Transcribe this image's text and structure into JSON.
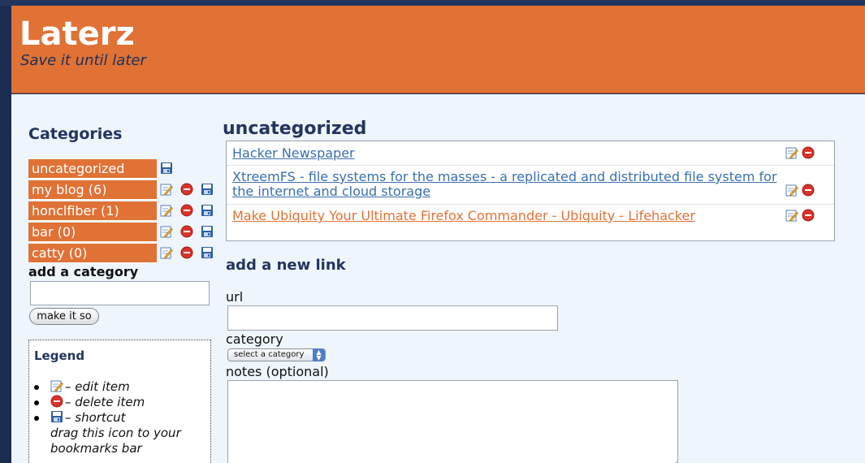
{
  "header": {
    "title": "Laterz",
    "subtitle": "Save it until later"
  },
  "sidebar": {
    "heading": "Categories",
    "categories": [
      {
        "label": "uncategorized",
        "icons": [
          "shortcut-icon"
        ]
      },
      {
        "label": "my blog (6)",
        "icons": [
          "edit-icon",
          "delete-icon",
          "shortcut-icon"
        ]
      },
      {
        "label": "honclfiber (1)",
        "icons": [
          "edit-icon",
          "delete-icon",
          "shortcut-icon"
        ]
      },
      {
        "label": "bar (0)",
        "icons": [
          "edit-icon",
          "delete-icon",
          "shortcut-icon"
        ]
      },
      {
        "label": "catty (0)",
        "icons": [
          "edit-icon",
          "delete-icon",
          "shortcut-icon"
        ]
      }
    ],
    "add_category_label": "add a category",
    "add_category_value": "",
    "make_button": "make it so"
  },
  "legend": {
    "title": "Legend",
    "items": [
      {
        "icon": "edit-icon",
        "text": "– edit item"
      },
      {
        "icon": "delete-icon",
        "text": "– delete item"
      },
      {
        "icon": "shortcut-icon",
        "text": "– shortcut",
        "note": "drag this icon to your bookmarks bar"
      }
    ]
  },
  "main": {
    "title": "uncategorized",
    "links": [
      {
        "text": "Hacker Newspaper",
        "visited": false
      },
      {
        "text": "XtreemFS - file systems for the masses - a replicated and distributed file system for the internet and cloud storage",
        "visited": false
      },
      {
        "text": "Make Ubiquity Your Ultimate Firefox Commander - Ubiquity - Lifehacker",
        "visited": true
      }
    ]
  },
  "add_link": {
    "title": "add a new link",
    "url_label": "url",
    "url_value": "",
    "category_label": "category",
    "category_selected": "select a category",
    "notes_label": "notes (optional)",
    "notes_value": ""
  },
  "colors": {
    "accent": "#e07236",
    "navy": "#23355f",
    "background": "#eef5fb",
    "link": "#3a6fb0"
  }
}
